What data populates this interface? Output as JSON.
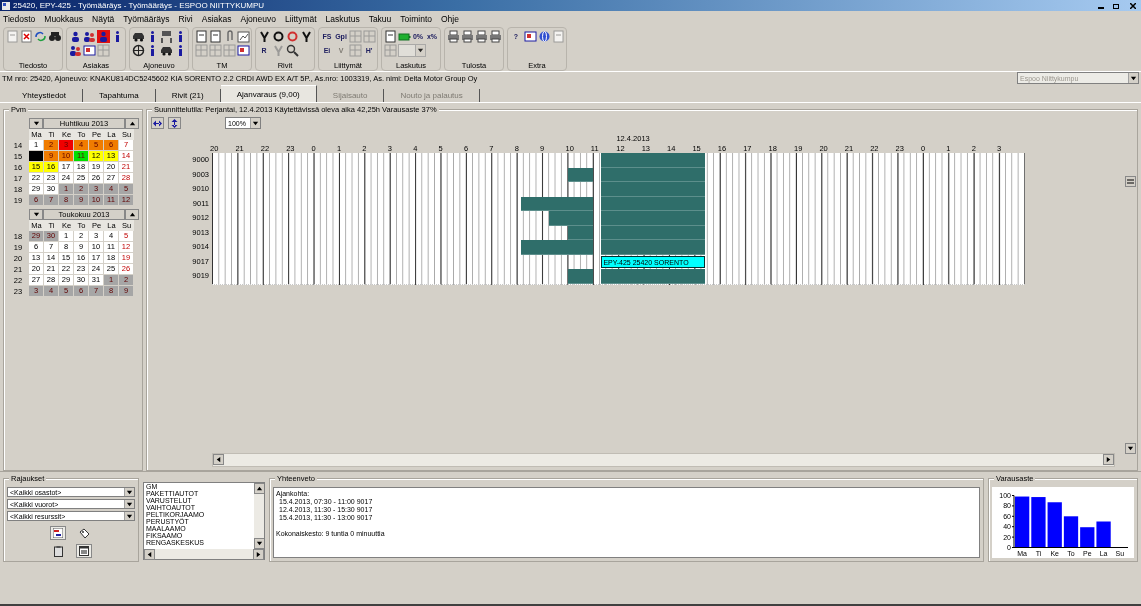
{
  "window": {
    "title": "25420, EPY-425 - Työmääräys - Työmääräys - ESPOO NIITTYKUMPU"
  },
  "menu": [
    "Tiedosto",
    "Muokkaus",
    "Näytä",
    "Työmääräys",
    "Rivi",
    "Asiakas",
    "Ajoneuvo",
    "Liittymät",
    "Laskutus",
    "Takuu",
    "Toiminto",
    "Ohje"
  ],
  "toolbar": [
    {
      "label": "Tiedosto",
      "rows": [
        [
          {
            "kind": "document",
            "disabled": true
          },
          {
            "kind": "delete",
            "disabled": false
          },
          {
            "kind": "refresh",
            "disabled": false
          },
          {
            "kind": "binoculars",
            "disabled": false
          }
        ]
      ]
    },
    {
      "label": "Asiakas",
      "rows": [
        [
          {
            "kind": "person",
            "disabled": false
          },
          {
            "kind": "people",
            "disabled": false
          },
          {
            "kind": "alert",
            "disabled": false
          },
          {
            "kind": "info",
            "disabled": false
          }
        ],
        [
          {
            "kind": "people",
            "disabled": false
          },
          {
            "kind": "card",
            "disabled": false
          },
          {
            "kind": "grid",
            "disabled": true
          }
        ]
      ]
    },
    {
      "label": "Ajoneuvo",
      "rows": [
        [
          {
            "kind": "car",
            "disabled": false
          },
          {
            "kind": "info",
            "disabled": false
          },
          {
            "kind": "lift",
            "disabled": false
          },
          {
            "kind": "info",
            "disabled": false
          }
        ],
        [
          {
            "kind": "wheel",
            "disabled": false
          },
          {
            "kind": "info",
            "disabled": false
          },
          {
            "kind": "car",
            "disabled": false
          },
          {
            "kind": "info",
            "disabled": false
          }
        ]
      ]
    },
    {
      "label": "TM",
      "rows": [
        [
          {
            "kind": "document",
            "disabled": false
          },
          {
            "kind": "document",
            "disabled": false
          },
          {
            "kind": "clip",
            "disabled": false
          },
          {
            "kind": "chart",
            "disabled": false
          }
        ],
        [
          {
            "kind": "grid",
            "disabled": true
          },
          {
            "kind": "grid",
            "disabled": true
          },
          {
            "kind": "grid",
            "disabled": true
          },
          {
            "kind": "card",
            "disabled": false
          }
        ]
      ]
    },
    {
      "label": "Rivit",
      "rows": [
        [
          {
            "kind": "tool",
            "disabled": false
          },
          {
            "kind": "ring",
            "disabled": false
          },
          {
            "kind": "redring",
            "disabled": false
          },
          {
            "kind": "tool",
            "disabled": false
          }
        ],
        [
          {
            "kind": "text",
            "label": "R",
            "disabled": false
          },
          {
            "kind": "tool",
            "disabled": true
          },
          {
            "kind": "magnifier",
            "disabled": false
          }
        ]
      ]
    },
    {
      "label": "Liittymät",
      "rows": [
        [
          {
            "kind": "text",
            "label": "FS",
            "disabled": false
          },
          {
            "kind": "text",
            "label": "Gpi",
            "disabled": false
          },
          {
            "kind": "grid",
            "disabled": true
          },
          {
            "kind": "grid",
            "disabled": true
          }
        ],
        [
          {
            "kind": "text",
            "label": "Ei",
            "disabled": false
          },
          {
            "kind": "text",
            "label": "V",
            "disabled": true
          },
          {
            "kind": "grid",
            "disabled": true
          },
          {
            "kind": "text",
            "label": "H'",
            "disabled": false
          }
        ]
      ]
    },
    {
      "label": "Laskutus",
      "rows": [
        [
          {
            "kind": "document",
            "disabled": false
          },
          {
            "kind": "battery",
            "disabled": false
          },
          {
            "kind": "text",
            "label": "0%",
            "disabled": false
          },
          {
            "kind": "text",
            "label": "x%",
            "disabled": false
          }
        ],
        [
          {
            "kind": "grid",
            "disabled": true
          },
          {
            "kind": "combo",
            "disabled": true
          }
        ]
      ]
    },
    {
      "label": "Tulosta",
      "rows": [
        [
          {
            "kind": "printer",
            "disabled": false
          },
          {
            "kind": "printer",
            "disabled": false
          },
          {
            "kind": "printer",
            "disabled": false
          },
          {
            "kind": "printer",
            "disabled": false
          }
        ]
      ]
    },
    {
      "label": "Extra",
      "rows": [
        [
          {
            "kind": "text",
            "label": "?",
            "disabled": false
          },
          {
            "kind": "card",
            "disabled": false
          },
          {
            "kind": "globe",
            "disabled": false
          },
          {
            "kind": "document",
            "disabled": true
          }
        ]
      ]
    }
  ],
  "info_line": "TM nro: 25420, Ajoneuvo: KNAKU814DC5245602 KIA SORENTO 2.2 CRDI AWD EX A/T 5P., As.nro: 1003319, As. nimi: Delta Motor Group Oy",
  "location_select": {
    "value": "Espoo Niittykumpu",
    "disabled": true
  },
  "tabs": [
    {
      "label": "Yhteystiedot",
      "selected": false,
      "disabled": false
    },
    {
      "label": "Tapahtuma",
      "selected": false,
      "disabled": false
    },
    {
      "label": "Rivit (21)",
      "selected": false,
      "disabled": false
    },
    {
      "label": "Ajanvaraus (9,00)",
      "selected": true,
      "disabled": false
    },
    {
      "label": "Sijaisauto",
      "selected": false,
      "disabled": true
    },
    {
      "label": "Nouto ja palautus",
      "selected": false,
      "disabled": true
    }
  ],
  "date_panel": {
    "title": "Pvm",
    "calendars": [
      {
        "title": "Huhtikuu 2013",
        "weekdays": [
          "Ma",
          "Ti",
          "Ke",
          "To",
          "Pe",
          "La",
          "Su"
        ],
        "weeks": [
          {
            "number": "14",
            "days": [
              {
                "day": "1",
                "color": "#ffffff"
              },
              {
                "day": "2",
                "color": "#f07c00"
              },
              {
                "day": "3",
                "color": "#f00000"
              },
              {
                "day": "4",
                "color": "#f07c00"
              },
              {
                "day": "5",
                "color": "#f07c00"
              },
              {
                "day": "6",
                "color": "#f07c00"
              },
              {
                "day": "7",
                "color": "#ffffff"
              }
            ]
          },
          {
            "number": "15",
            "days": [
              {
                "color": "#000000"
              },
              {
                "day": "9",
                "color": "#f07c00"
              },
              {
                "day": "10",
                "color": "#f07c00"
              },
              {
                "day": "11",
                "color": "#00e000"
              },
              {
                "day": "12",
                "color": "#ffff00"
              },
              {
                "day": "13",
                "color": "#ffff00"
              },
              {
                "day": "14",
                "color": "#ffffff"
              }
            ]
          },
          {
            "number": "16",
            "days": [
              {
                "day": "15",
                "color": "#ffff00"
              },
              {
                "day": "16",
                "color": "#ffff00"
              },
              {
                "day": "17",
                "color": "#ffffff"
              },
              {
                "day": "18",
                "color": "#ffffff"
              },
              {
                "day": "19",
                "color": "#ffffff"
              },
              {
                "day": "20",
                "color": "#ffffff"
              },
              {
                "day": "21",
                "color": "#ffffff"
              }
            ]
          },
          {
            "number": "17",
            "days": [
              {
                "day": "22",
                "color": "#ffffff"
              },
              {
                "day": "23",
                "color": "#ffffff"
              },
              {
                "day": "24",
                "color": "#ffffff"
              },
              {
                "day": "25",
                "color": "#ffffff"
              },
              {
                "day": "26",
                "color": "#ffffff"
              },
              {
                "day": "27",
                "color": "#ffffff"
              },
              {
                "day": "28",
                "color": "#ffffff"
              }
            ]
          },
          {
            "number": "18",
            "days": [
              {
                "day": "29",
                "color": "#ffffff"
              },
              {
                "day": "30",
                "color": "#ffffff"
              },
              {
                "day": "1",
                "color": "#a6a6a6"
              },
              {
                "day": "2",
                "color": "#a6a6a6"
              },
              {
                "day": "3",
                "color": "#a6a6a6"
              },
              {
                "day": "4",
                "color": "#a6a6a6"
              },
              {
                "day": "5",
                "color": "#a6a6a6"
              }
            ]
          },
          {
            "number": "19",
            "days": [
              {
                "day": "6",
                "color": "#a6a6a6"
              },
              {
                "day": "7",
                "color": "#a6a6a6"
              },
              {
                "day": "8",
                "color": "#a6a6a6"
              },
              {
                "day": "9",
                "color": "#a6a6a6"
              },
              {
                "day": "10",
                "color": "#a6a6a6"
              },
              {
                "day": "11",
                "color": "#a6a6a6"
              },
              {
                "day": "12",
                "color": "#a6a6a6"
              }
            ]
          }
        ]
      },
      {
        "title": "Toukokuu 2013",
        "weekdays": [
          "Ma",
          "Ti",
          "Ke",
          "To",
          "Pe",
          "La",
          "Su"
        ],
        "weeks": [
          {
            "number": "18",
            "days": [
              {
                "day": "29",
                "color": "#a6a6a6"
              },
              {
                "day": "30",
                "color": "#a6a6a6"
              },
              {
                "day": "1",
                "color": "#ffffff"
              },
              {
                "day": "2",
                "color": "#ffffff"
              },
              {
                "day": "3",
                "color": "#ffffff"
              },
              {
                "day": "4",
                "color": "#ffffff"
              },
              {
                "day": "5",
                "color": "#ffffff"
              }
            ]
          },
          {
            "number": "19",
            "days": [
              {
                "day": "6",
                "color": "#ffffff"
              },
              {
                "day": "7",
                "color": "#ffffff"
              },
              {
                "day": "8",
                "color": "#ffffff"
              },
              {
                "day": "9",
                "color": "#ffffff"
              },
              {
                "day": "10",
                "color": "#ffffff"
              },
              {
                "day": "11",
                "color": "#ffffff"
              },
              {
                "day": "12",
                "color": "#ffffff"
              }
            ]
          },
          {
            "number": "20",
            "days": [
              {
                "day": "13",
                "color": "#ffffff"
              },
              {
                "day": "14",
                "color": "#ffffff"
              },
              {
                "day": "15",
                "color": "#ffffff"
              },
              {
                "day": "16",
                "color": "#ffffff"
              },
              {
                "day": "17",
                "color": "#ffffff"
              },
              {
                "day": "18",
                "color": "#ffffff"
              },
              {
                "day": "19",
                "color": "#ffffff"
              }
            ]
          },
          {
            "number": "21",
            "days": [
              {
                "day": "20",
                "color": "#ffffff"
              },
              {
                "day": "21",
                "color": "#ffffff"
              },
              {
                "day": "22",
                "color": "#ffffff"
              },
              {
                "day": "23",
                "color": "#ffffff"
              },
              {
                "day": "24",
                "color": "#ffffff"
              },
              {
                "day": "25",
                "color": "#ffffff"
              },
              {
                "day": "26",
                "color": "#ffffff"
              }
            ]
          },
          {
            "number": "22",
            "days": [
              {
                "day": "27",
                "color": "#ffffff"
              },
              {
                "day": "28",
                "color": "#ffffff"
              },
              {
                "day": "29",
                "color": "#ffffff"
              },
              {
                "day": "30",
                "color": "#ffffff"
              },
              {
                "day": "31",
                "color": "#ffffff"
              },
              {
                "day": "1",
                "color": "#a6a6a6"
              },
              {
                "day": "2",
                "color": "#a6a6a6"
              }
            ]
          },
          {
            "number": "23",
            "days": [
              {
                "day": "3",
                "color": "#a6a6a6"
              },
              {
                "day": "4",
                "color": "#a6a6a6"
              },
              {
                "day": "5",
                "color": "#a6a6a6"
              },
              {
                "day": "6",
                "color": "#a6a6a6"
              },
              {
                "day": "7",
                "color": "#a6a6a6"
              },
              {
                "day": "8",
                "color": "#a6a6a6"
              },
              {
                "day": "9",
                "color": "#a6a6a6"
              }
            ]
          }
        ]
      }
    ]
  },
  "planner": {
    "status": "Suunnittelutila: Perjantai, 12.4.2013 Käytettävissä oleva aika 42,25h Varausaste 37%",
    "zoom": "100%",
    "hours": [
      {
        "label": "20"
      },
      {
        "label": "21"
      },
      {
        "label": "22"
      },
      {
        "label": "23"
      },
      {
        "label": "0"
      },
      {
        "label": "1"
      },
      {
        "label": "2"
      },
      {
        "label": "3"
      },
      {
        "label": "4"
      },
      {
        "label": "5"
      },
      {
        "label": "6"
      },
      {
        "label": "7"
      },
      {
        "label": "8"
      },
      {
        "label": "9"
      },
      {
        "label": "10"
      },
      {
        "label": "11"
      },
      {
        "label": "12",
        "date": "12.4.2013"
      },
      {
        "label": "13"
      },
      {
        "label": "14"
      },
      {
        "label": "15"
      },
      {
        "label": "16"
      },
      {
        "label": "17"
      },
      {
        "label": "18"
      },
      {
        "label": "19"
      },
      {
        "label": "20"
      },
      {
        "label": "21"
      },
      {
        "label": "22"
      },
      {
        "label": "23"
      },
      {
        "label": "0"
      },
      {
        "label": "1"
      },
      {
        "label": "2"
      },
      {
        "label": "3"
      }
    ],
    "rows": [
      {
        "resource": "9000",
        "bookings": [
          {
            "kind": "afternoon"
          }
        ]
      },
      {
        "resource": "9003",
        "bookings": [
          {
            "kind": "hour"
          },
          {
            "kind": "afternoon"
          }
        ]
      },
      {
        "resource": "9010",
        "bookings": [
          {
            "kind": "afternoon"
          }
        ]
      },
      {
        "resource": "9011",
        "bookings": [
          {
            "kind": "morning"
          },
          {
            "kind": "afternoon"
          }
        ]
      },
      {
        "resource": "9012",
        "bookings": [
          {
            "kind": "late-morning"
          },
          {
            "kind": "afternoon"
          }
        ]
      },
      {
        "resource": "9013",
        "bookings": [
          {
            "kind": "hour"
          },
          {
            "kind": "afternoon"
          }
        ]
      },
      {
        "resource": "9014",
        "bookings": [
          {
            "kind": "morning"
          },
          {
            "kind": "afternoon"
          }
        ]
      },
      {
        "resource": "9017",
        "bookings": [
          {
            "kind": "selected",
            "label": "EPY-425 25420 SORENTO"
          }
        ]
      },
      {
        "resource": "9019",
        "bookings": [
          {
            "kind": "hour"
          },
          {
            "kind": "afternoon"
          }
        ]
      }
    ]
  },
  "filters": {
    "title": "Rajaukset",
    "selects": [
      "<Kaikki osastot>",
      "<Kaikki vuorot>",
      "<Kaikki resurssit>"
    ],
    "buttons": [
      {
        "kind": "gantt",
        "selected": true
      },
      {
        "kind": "tag",
        "selected": false
      },
      {
        "kind": "clipboard",
        "selected": false
      },
      {
        "kind": "window",
        "selected": true
      }
    ]
  },
  "departments": [
    "GM",
    "PAKETTIAUTOT",
    "VARUSTELUT",
    "VAIHTOAUTOT",
    "PELTIKORJAAMO",
    "PERUSTYÖT",
    "MAALAAMO",
    "FIKSAAMO",
    "RENGASKESKUS"
  ],
  "summary": {
    "title": "Yhteenveto",
    "heading": "Ajankohta:",
    "entries": [
      "15.4.2013, 07:30 - 11:00 9017",
      "12.4.2013, 11:30 - 15:30 9017",
      "15.4.2013, 11:30 - 13:00 9017"
    ],
    "total": "Kokonaiskesto: 9 tuntia 0 minuuttia"
  },
  "occupancy": {
    "title": "Varausaste",
    "chart_data": {
      "type": "bar",
      "categories": [
        "Ma",
        "Ti",
        "Ke",
        "To",
        "Pe",
        "La",
        "Su"
      ],
      "series": [
        {
          "color": "#0000ff",
          "values": [
            98,
            97,
            87,
            60,
            39,
            50,
            null
          ]
        }
      ],
      "ylim": [
        0,
        100
      ],
      "yticks": [
        0,
        20,
        40,
        60,
        80,
        100
      ]
    }
  }
}
